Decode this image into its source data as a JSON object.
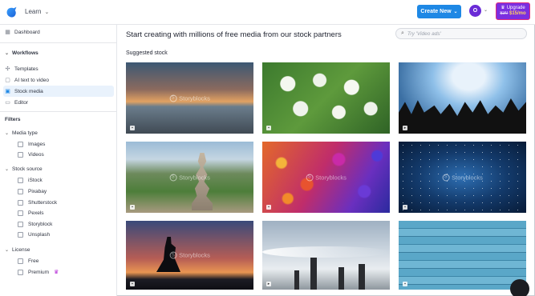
{
  "topbar": {
    "learn_label": "Learn",
    "create_new_label": "Create New",
    "avatar_letter": "O",
    "upgrade": {
      "label": "Upgrade",
      "old_price": "$30",
      "new_price": "$15/mo"
    }
  },
  "sidebar": {
    "dashboard": "Dashboard",
    "workflows_title": "Workflows",
    "workflows": [
      "Templates",
      "AI text to video",
      "Stock media",
      "Editor"
    ],
    "active_item": "Stock media",
    "filters_title": "Filters",
    "media_type": {
      "title": "Media type",
      "options": [
        "Images",
        "Videos"
      ]
    },
    "stock_source": {
      "title": "Stock source",
      "options": [
        "iStock",
        "Pixabay",
        "Shutterstock",
        "Pexels",
        "Storyblock",
        "Unsplash"
      ]
    },
    "license": {
      "title": "License",
      "options": [
        "Free",
        "Premium"
      ]
    }
  },
  "main": {
    "title": "Start creating with millions of free media from our stock partners",
    "search_placeholder": "Try 'Video ads'",
    "suggested_title": "Suggested stock",
    "tiles": [
      {
        "subject": "lake-sunset",
        "watermark": "Storyblocks",
        "type": "image"
      },
      {
        "subject": "white-flowers",
        "watermark": "",
        "type": "image"
      },
      {
        "subject": "concert-crowd",
        "watermark": "",
        "type": "video"
      },
      {
        "subject": "stacked-stones",
        "watermark": "Storyblocks",
        "type": "image"
      },
      {
        "subject": "colorful-bokeh",
        "watermark": "Storyblocks",
        "type": "image"
      },
      {
        "subject": "starry-space",
        "watermark": "Storyblocks",
        "type": "image"
      },
      {
        "subject": "silhouette-sunset",
        "watermark": "Storyblocks",
        "type": "image"
      },
      {
        "subject": "factory-smoke",
        "watermark": "",
        "type": "video"
      },
      {
        "subject": "blue-wood-planks",
        "watermark": "",
        "type": "image"
      }
    ]
  },
  "colors": {
    "accent": "#1e88e5",
    "upgrade": "#7b2fe0",
    "active_bg": "#e9f2fc"
  }
}
